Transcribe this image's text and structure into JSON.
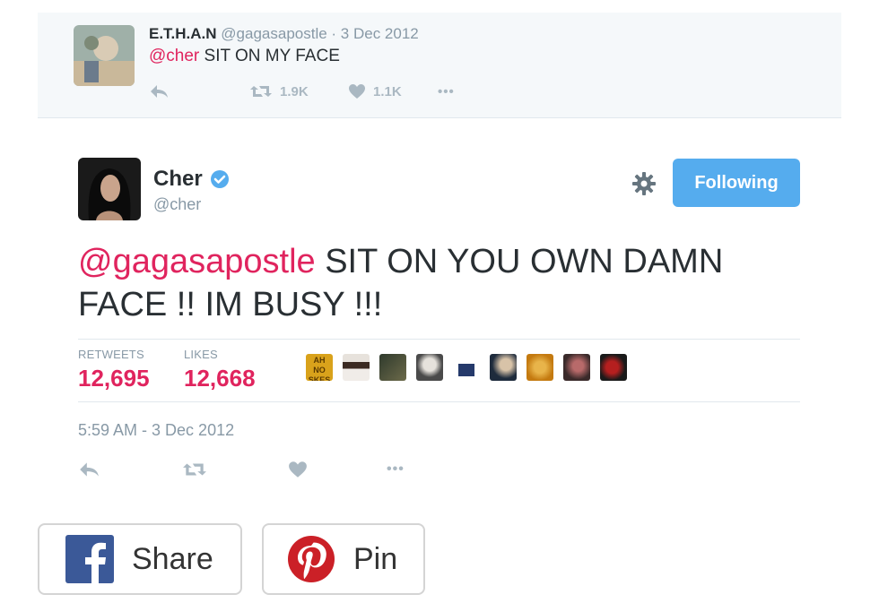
{
  "parent_tweet": {
    "name": "E.T.H.A.N",
    "meta": "@gagasapostle · 3 Dec 2012",
    "mention": "@cher",
    "text": "SIT ON MY FACE",
    "retweets": "1.9K",
    "likes": "1.1K",
    "more": "•••"
  },
  "main_tweet": {
    "name": "Cher",
    "handle": "@cher",
    "follow_label": "Following",
    "mention": "@gagasapostle",
    "text": " SIT ON YOU OWN DAMN FACE !! IM BUSY !!!",
    "stats": {
      "retweets_label": "RETWEETS",
      "retweets_value": "12,695",
      "likes_label": "LIKES",
      "likes_value": "12,668"
    },
    "timestamp": "5:59 AM - 3 Dec 2012",
    "more": "•••",
    "first_liker_avatar_text": "AH NO SKES"
  },
  "share": {
    "facebook_label": "Share",
    "pinterest_label": "Pin"
  },
  "colors": {
    "accent": "#55acee",
    "mention": "#e0245e",
    "muted": "#8899a6",
    "facebook": "#3b5998",
    "pinterest": "#cb2027"
  }
}
